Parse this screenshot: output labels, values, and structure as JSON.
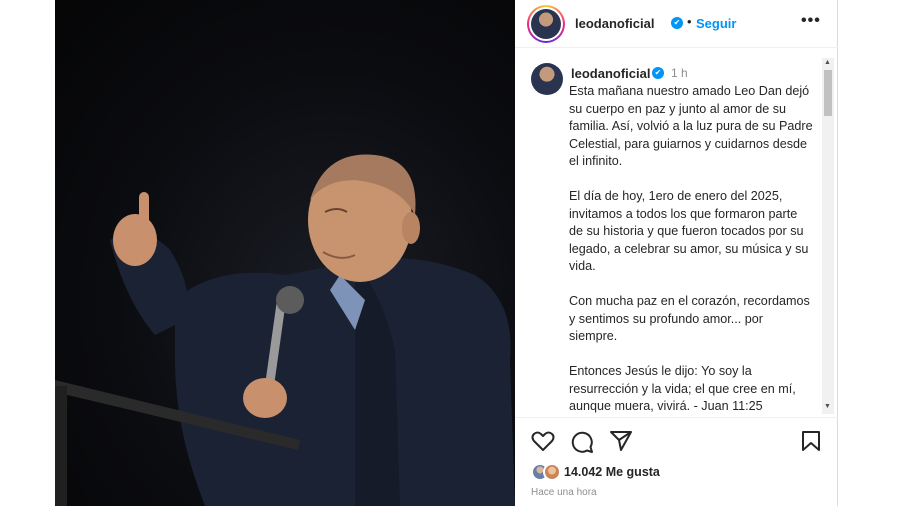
{
  "post": {
    "username": "leodanoficial",
    "follow_label": "Seguir",
    "dot_separator": "•",
    "more_label": "•••",
    "caption_time": "1 h",
    "caption_paragraphs": [
      "Esta mañana nuestro amado Leo Dan dejó su cuerpo en paz y junto al amor de su familia. Así, volvió a la luz pura de su Padre Celestial, para guiarnos y cuidarnos desde el infinito.",
      "El día de hoy, 1ero de enero del 2025, invitamos a todos los que formaron parte de su historia y que fueron tocados por su legado, a celebrar su amor, su música y su vida.",
      "Con mucha paz en el corazón, recordamos y sentimos su profundo amor... por siempre.",
      "Entonces Jesús le dijo: Yo soy la resurrección y la vida; el que cree en mí, aunque muera, vivirá. - Juan 11:25"
    ],
    "likes_text": "14.042 Me gusta",
    "posted_ago": "Hace una hora"
  },
  "icons": {
    "verified": "verified-badge-icon",
    "like": "heart-icon",
    "comment": "comment-bubble-icon",
    "share": "paper-plane-icon",
    "save": "bookmark-icon"
  },
  "colors": {
    "accent": "#0095f6",
    "text": "#262626",
    "muted": "#8e8e8e",
    "photo_bg": "#0b0c10"
  }
}
